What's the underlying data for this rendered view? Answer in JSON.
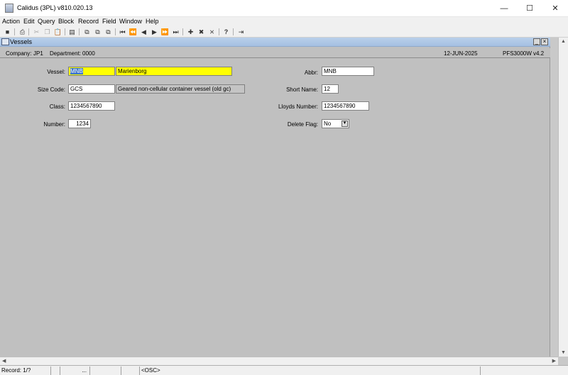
{
  "window": {
    "title": "Calidus (3PL) v810.020.13",
    "minimize": "—",
    "maximize": "☐",
    "close": "✕"
  },
  "menu": [
    "Action",
    "Edit",
    "Query",
    "Block",
    "Record",
    "Field",
    "Window",
    "Help"
  ],
  "toolbar_icons": [
    "save-icon",
    "print-icon",
    "cut-icon",
    "copy-icon",
    "paste-icon",
    "clear-icon",
    "enter-query-icon",
    "execute-query-icon",
    "cancel-query-icon",
    "first-record-icon",
    "previous-block-icon",
    "previous-record-icon",
    "next-record-icon",
    "next-block-icon",
    "last-record-icon",
    "insert-record-icon",
    "delete-record-icon",
    "clear-record-icon",
    "help-icon",
    "exit-icon"
  ],
  "form": {
    "title": "Vessels",
    "company_label": "Company:",
    "company": "JP1",
    "department_label": "Department:",
    "department": "0000",
    "date": "12-JUN-2025",
    "form_code": "PFS3000W",
    "version": "v4.2",
    "vessel_label": "Vessel:",
    "vessel_code": "MNB",
    "vessel_name": "Marienborg",
    "size_code_label": "Size Code:",
    "size_code": "GCS",
    "size_code_desc": "Geared non-cellular container vessel (old gc)",
    "class_label": "Class:",
    "class": "1234567890",
    "number_label": "Number:",
    "number": "1234",
    "abbr_label": "Abbr:",
    "abbr": "MNB",
    "short_name_label": "Short Name:",
    "short_name": "12",
    "lloyds_label": "Lloyds Number:",
    "lloyds": "1234567890",
    "delete_flag_label": "Delete Flag:",
    "delete_flag": "No"
  },
  "status": {
    "record": "Record: 1/?",
    "ellipsis": "...",
    "osc": "<OSC>"
  },
  "colors": {
    "required_field": "#ffff00",
    "form_bg": "#c0c0c0",
    "title_bar": "#a5c0e2"
  }
}
